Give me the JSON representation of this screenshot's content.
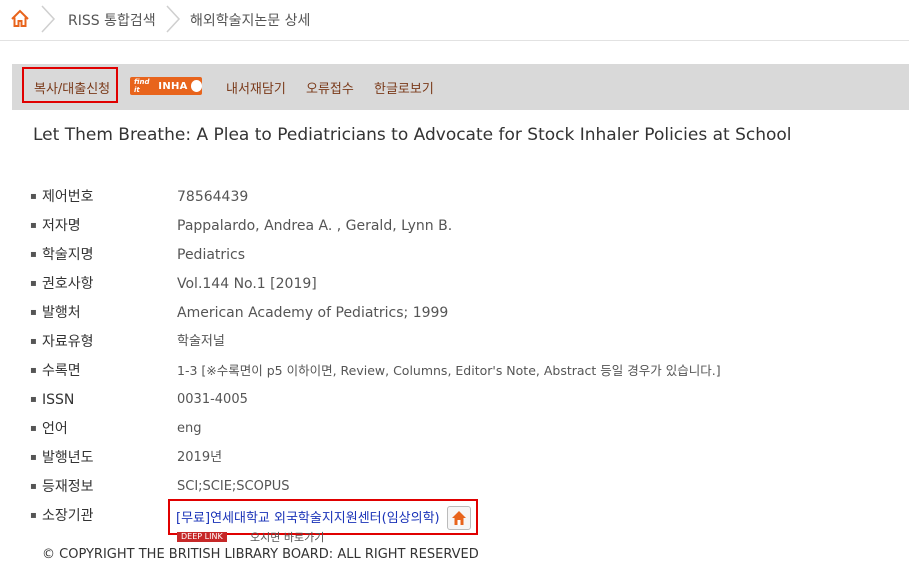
{
  "breadcrumb": {
    "items": [
      "RISS 통합검색",
      "해외학술지논문 상세"
    ]
  },
  "toolbar": {
    "copy_loan": "복사/대출신청",
    "findit_prefix": "find it",
    "findit_name": "INHA",
    "save": "내서재담기",
    "error_report": "오류접수",
    "hangul_view": "한글로보기"
  },
  "article": {
    "title": "Let Them Breathe: A Plea to Pediatricians to Advocate for Stock Inhaler Policies at School"
  },
  "fields": [
    {
      "label": "제어번호",
      "value": "78564439"
    },
    {
      "label": "저자명",
      "value": "Pappalardo, Andrea A. , Gerald, Lynn B."
    },
    {
      "label": "학술지명",
      "value": "Pediatrics"
    },
    {
      "label": "권호사항",
      "value": "Vol.144 No.1 [2019]"
    },
    {
      "label": "발행처",
      "value": "American Academy of Pediatrics; 1999"
    },
    {
      "label": "자료유형",
      "value": "학술저널"
    },
    {
      "label": "수록면",
      "value": "1-3   [※수록면이 p5 이하이면, Review, Columns, Editor's Note, Abstract 등일 경우가 있습니다.]"
    },
    {
      "label": "ISSN",
      "value": "0031-4005"
    },
    {
      "label": "언어",
      "value": "eng"
    },
    {
      "label": "발행년도",
      "value": "2019년"
    },
    {
      "label": "등재정보",
      "value": "SCI;SCIE;SCOPUS"
    },
    {
      "label": "소장기관",
      "value": ""
    }
  ],
  "holding": {
    "link": "[무료]연세대학교 외국학술지지원센터(임상의학)",
    "deeplink_badge": "DEEP LINK",
    "deeplink_text": "오시면 바로가기"
  },
  "footer": {
    "copyright": "© COPYRIGHT THE BRITISH LIBRARY BOARD: ALL RIGHT RESERVED"
  },
  "colors": {
    "highlight_border": "#e00000",
    "toolbar_bg": "#d9d9d9",
    "toolbar_text": "#7a3a1a",
    "link": "#1a33b8",
    "home_icon": "#e8641c"
  },
  "icons": [
    "home-icon",
    "chevron-right-icon",
    "findit-logo",
    "home-button-icon",
    "deeplink-icon"
  ]
}
